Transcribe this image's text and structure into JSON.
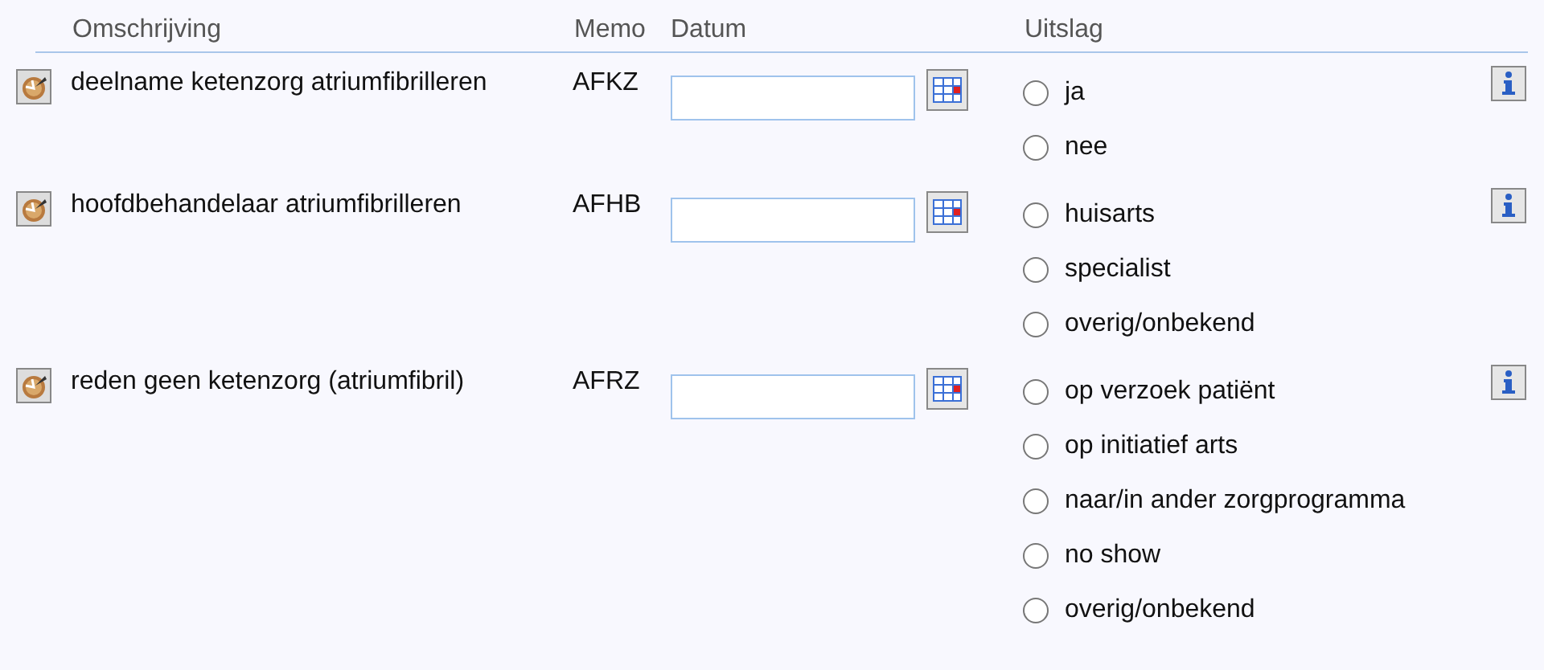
{
  "columns": [
    "Omschrijving",
    "Memo",
    "Datum",
    "Uitslag"
  ],
  "rows": [
    {
      "description": "deelname ketenzorg atriumfibrilleren",
      "memo": "AFKZ",
      "options": [
        {
          "label": "ja",
          "selected": false
        },
        {
          "label": "nee",
          "selected": false
        }
      ]
    },
    {
      "description": "hoofdbehandelaar atriumfibrilleren",
      "memo": "AFHB",
      "options": [
        {
          "label": "huisarts",
          "selected": false
        },
        {
          "label": "specialist",
          "selected": false
        },
        {
          "label": "overig/onbekend",
          "selected": false
        }
      ]
    },
    {
      "description": "reden geen ketenzorg (atriumfibril)",
      "memo": "AFRZ",
      "options": [
        {
          "label": "op verzoek patiënt",
          "selected": false
        },
        {
          "label": "op initiatief arts",
          "selected": false
        },
        {
          "label": "naar/in ander zorgprogramma",
          "selected": false
        },
        {
          "label": "no show",
          "selected": false
        },
        {
          "label": "overig/onbekend",
          "selected": false
        }
      ]
    }
  ]
}
